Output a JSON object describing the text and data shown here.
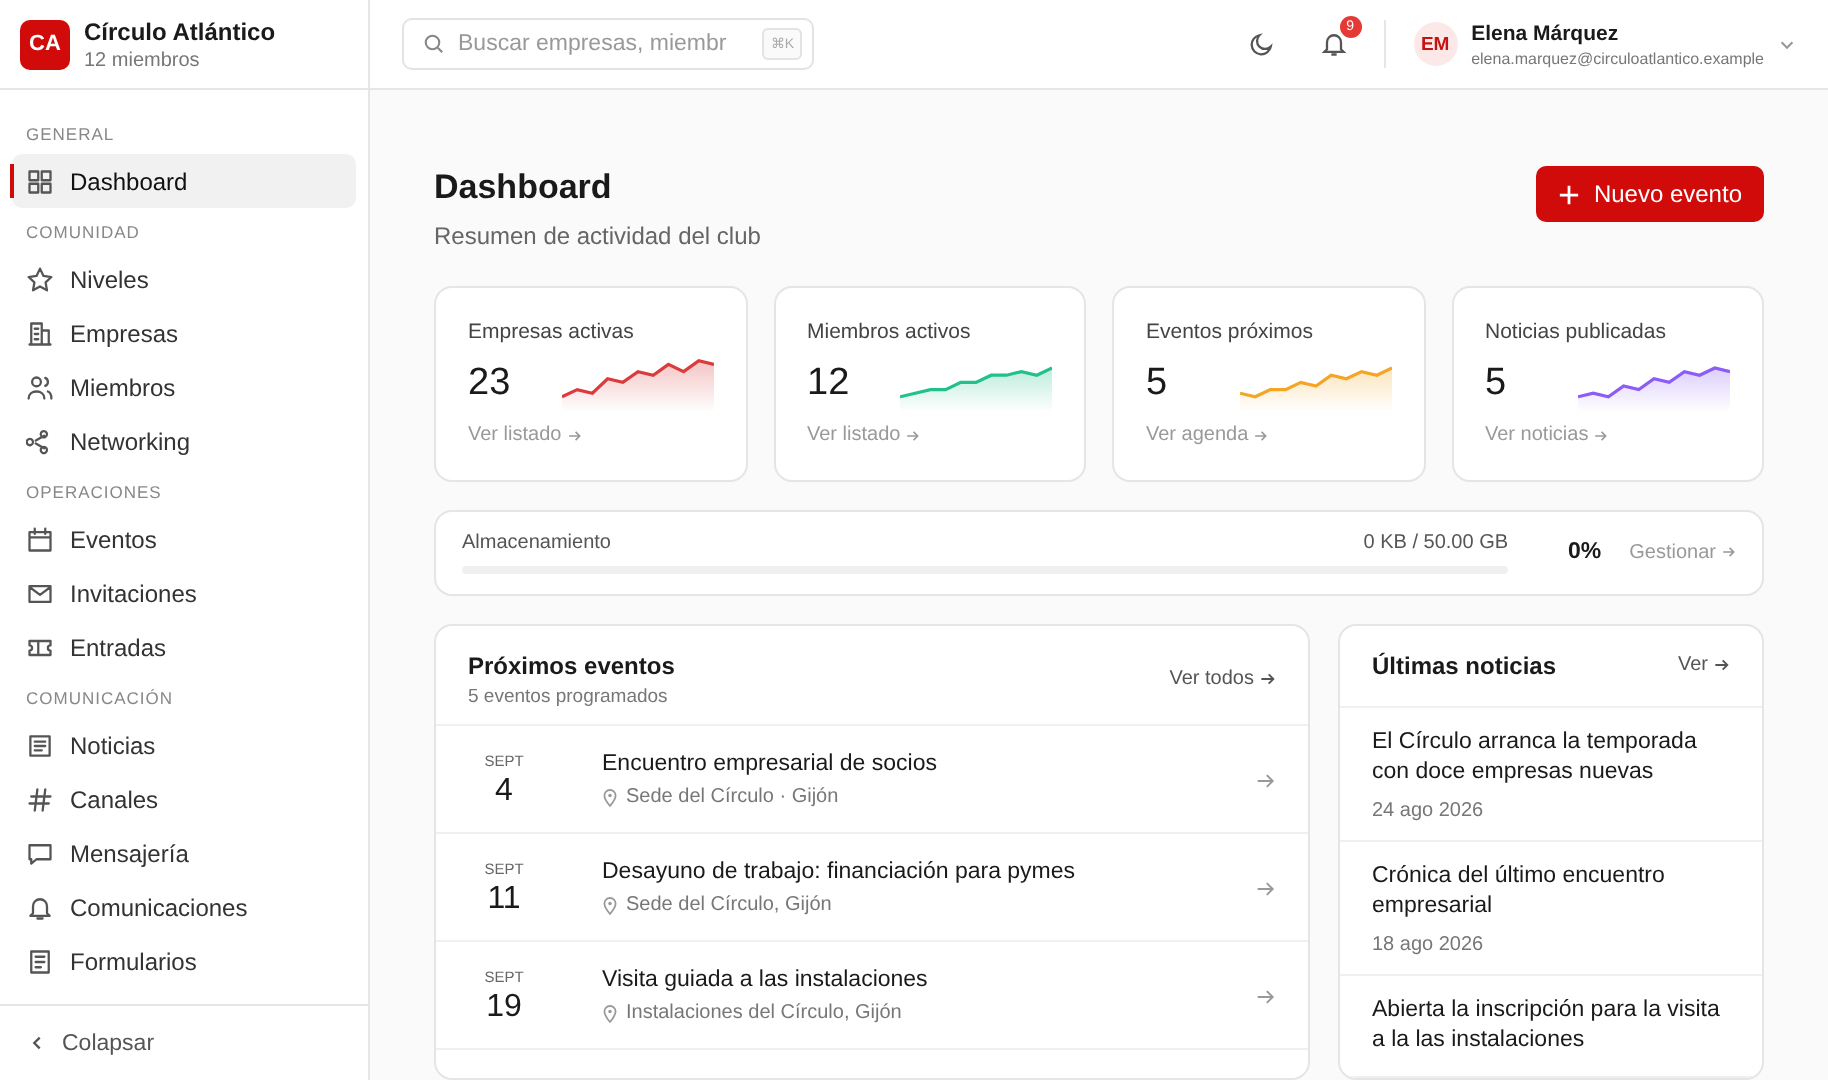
{
  "org": {
    "initials": "CA",
    "name": "Círculo Atlántico",
    "members": "12 miembros"
  },
  "search": {
    "placeholder": "Buscar empresas, miembr",
    "shortcut": "⌘K"
  },
  "notifications": {
    "count": "9"
  },
  "user": {
    "initials": "EM",
    "name": "Elena Márquez",
    "email": "elena.marquez@circuloatlantico.example"
  },
  "sidebar": {
    "sections": [
      {
        "title": "GENERAL",
        "items": [
          {
            "label": "Dashboard",
            "selected": true
          }
        ]
      },
      {
        "title": "COMUNIDAD",
        "items": [
          {
            "label": "Niveles",
            "selected": false
          },
          {
            "label": "Empresas",
            "selected": false
          },
          {
            "label": "Miembros",
            "selected": false
          },
          {
            "label": "Networking",
            "selected": false
          }
        ]
      },
      {
        "title": "OPERACIONES",
        "items": [
          {
            "label": "Eventos",
            "selected": false
          },
          {
            "label": "Invitaciones",
            "selected": false
          },
          {
            "label": "Entradas",
            "selected": false
          }
        ]
      },
      {
        "title": "COMUNICACIÓN",
        "items": [
          {
            "label": "Noticias",
            "selected": false
          },
          {
            "label": "Canales",
            "selected": false
          },
          {
            "label": "Mensajería",
            "selected": false
          },
          {
            "label": "Comunicaciones",
            "selected": false
          },
          {
            "label": "Formularios",
            "selected": false
          }
        ]
      }
    ],
    "collapse": "Colapsar"
  },
  "page": {
    "title": "Dashboard",
    "subtitle": "Resumen de actividad del club",
    "new_button": "Nuevo evento"
  },
  "stats": [
    {
      "label": "Empresas activas",
      "value": "23",
      "link": "Ver listado",
      "color": "#dc3b3b"
    },
    {
      "label": "Miembros activos",
      "value": "12",
      "link": "Ver listado",
      "color": "#22c08a"
    },
    {
      "label": "Eventos próximos",
      "value": "5",
      "link": "Ver agenda",
      "color": "#f5a524"
    },
    {
      "label": "Noticias publicadas",
      "value": "5",
      "link": "Ver noticias",
      "color": "#8b5cf6"
    }
  ],
  "storage": {
    "label": "Almacenamiento",
    "usage": "0 KB / 50.00 GB",
    "level": 0,
    "percent": "0%",
    "link": "Gestionar"
  },
  "events": {
    "title": "Próximos eventos",
    "subtitle": "5 eventos programados",
    "link": "Ver todos",
    "items": [
      {
        "month": "SEPT",
        "day": "4",
        "title": "Encuentro empresarial de socios",
        "place": "Sede del Círculo · Gijón"
      },
      {
        "month": "SEPT",
        "day": "11",
        "title": "Desayuno de trabajo: financiación para pymes",
        "place": "Sede del Círculo, Gijón"
      },
      {
        "month": "SEPT",
        "day": "19",
        "title": "Visita guiada a las instalaciones",
        "place": "Instalaciones del Círculo, Gijón"
      }
    ]
  },
  "news": {
    "title": "Últimas noticias",
    "link": "Ver",
    "items": [
      {
        "title": "El Círculo arranca la temporada con doce empresas nuevas",
        "date": "24 ago 2026"
      },
      {
        "title": "Crónica del último encuentro empresarial",
        "date": "18 ago 2026"
      },
      {
        "title": "Abierta la inscripción para la visita a la las instalaciones"
      }
    ]
  }
}
